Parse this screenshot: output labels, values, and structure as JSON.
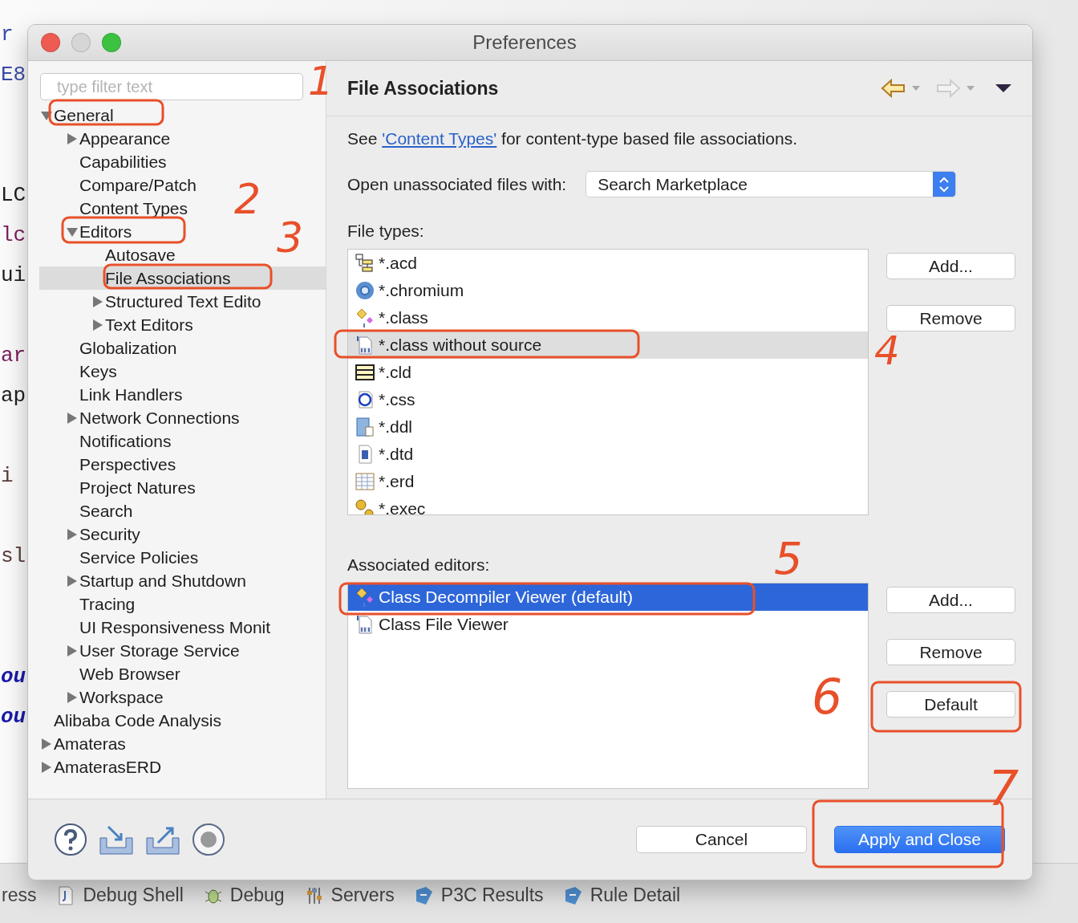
{
  "editor_background": {
    "code_lines": [
      {
        "kind": "code",
        "text": "r",
        "color": "#3b4ba8"
      },
      {
        "kind": "code",
        "text": "E8",
        "color": "#3b4ba8"
      },
      {
        "kind": "blank"
      },
      {
        "kind": "blank"
      },
      {
        "kind": "code",
        "text": "LC",
        "color": "#202020"
      },
      {
        "kind": "code",
        "text": "lc",
        "color": "#7a1c5a"
      },
      {
        "kind": "code",
        "text": "ui",
        "color": "#202020"
      },
      {
        "kind": "blank"
      },
      {
        "kind": "code",
        "text": "ar",
        "color": "#7a1c5a"
      },
      {
        "kind": "code",
        "text": "ap",
        "color": "#202020"
      },
      {
        "kind": "blank"
      },
      {
        "kind": "code",
        "text": "i",
        "color": "#5a3a3a"
      },
      {
        "kind": "blank"
      },
      {
        "kind": "code",
        "text": "sl",
        "color": "#5a3a3a"
      },
      {
        "kind": "blank"
      },
      {
        "kind": "blank"
      },
      {
        "kind": "code",
        "text": "ou",
        "color": "#1a1aa8"
      },
      {
        "kind": "code",
        "text": "ou",
        "color": "#1a1aa8"
      }
    ],
    "bottom_tabs": [
      "ress",
      "Debug Shell",
      "Debug",
      "Servers",
      "P3C Results",
      "Rule Detail"
    ]
  },
  "window": {
    "title": "Preferences"
  },
  "sidebar": {
    "filter": {
      "placeholder": "type filter text"
    },
    "tree": [
      {
        "label": "General",
        "kind": "branch",
        "expanded": true,
        "selected": false,
        "children": [
          {
            "label": "Appearance",
            "kind": "branch",
            "expanded": false,
            "selected": false
          },
          {
            "label": "Capabilities",
            "kind": "leaf",
            "selected": false
          },
          {
            "label": "Compare/Patch",
            "kind": "leaf",
            "selected": false
          },
          {
            "label": "Content Types",
            "kind": "leaf",
            "selected": false
          },
          {
            "label": "Editors",
            "kind": "branch",
            "expanded": true,
            "selected": false,
            "children": [
              {
                "label": "Autosave",
                "kind": "leaf",
                "selected": false
              },
              {
                "label": "File Associations",
                "kind": "leaf",
                "selected": true
              },
              {
                "label": "Structured Text Edito",
                "kind": "branch",
                "expanded": false,
                "selected": false
              },
              {
                "label": "Text Editors",
                "kind": "branch",
                "expanded": false,
                "selected": false
              }
            ]
          },
          {
            "label": "Globalization",
            "kind": "leaf",
            "selected": false
          },
          {
            "label": "Keys",
            "kind": "leaf",
            "selected": false
          },
          {
            "label": "Link Handlers",
            "kind": "leaf",
            "selected": false
          },
          {
            "label": "Network Connections",
            "kind": "branch",
            "expanded": false,
            "selected": false
          },
          {
            "label": "Notifications",
            "kind": "leaf",
            "selected": false
          },
          {
            "label": "Perspectives",
            "kind": "leaf",
            "selected": false
          },
          {
            "label": "Project Natures",
            "kind": "leaf",
            "selected": false
          },
          {
            "label": "Search",
            "kind": "leaf",
            "selected": false
          },
          {
            "label": "Security",
            "kind": "branch",
            "expanded": false,
            "selected": false
          },
          {
            "label": "Service Policies",
            "kind": "leaf",
            "selected": false
          },
          {
            "label": "Startup and Shutdown",
            "kind": "branch",
            "expanded": false,
            "selected": false
          },
          {
            "label": "Tracing",
            "kind": "leaf",
            "selected": false
          },
          {
            "label": "UI Responsiveness Monit",
            "kind": "leaf",
            "selected": false
          },
          {
            "label": "User Storage Service",
            "kind": "branch",
            "expanded": false,
            "selected": false
          },
          {
            "label": "Web Browser",
            "kind": "leaf",
            "selected": false
          },
          {
            "label": "Workspace",
            "kind": "branch",
            "expanded": false,
            "selected": false
          }
        ]
      },
      {
        "label": "Alibaba Code Analysis",
        "kind": "leaf",
        "selected": false
      },
      {
        "label": "Amateras",
        "kind": "branch",
        "expanded": false,
        "selected": false
      },
      {
        "label": "AmaterasERD",
        "kind": "branch",
        "expanded": false,
        "selected": false
      }
    ]
  },
  "page": {
    "title": "File Associations",
    "intro": {
      "before": "See ",
      "link": "'Content Types'",
      "after": " for content-type based file associations."
    },
    "unassociated": {
      "label": "Open unassociated files with:",
      "value": "Search Marketplace"
    },
    "file_types": {
      "label": "File types:",
      "items": [
        {
          "text": "*.acd",
          "selected": false
        },
        {
          "text": "*.chromium",
          "selected": false
        },
        {
          "text": "*.class",
          "selected": false
        },
        {
          "text": "*.class without source",
          "selected": true
        },
        {
          "text": "*.cld",
          "selected": false
        },
        {
          "text": "*.css",
          "selected": false
        },
        {
          "text": "*.ddl",
          "selected": false
        },
        {
          "text": "*.dtd",
          "selected": false
        },
        {
          "text": "*.erd",
          "selected": false
        },
        {
          "text": "*.exec",
          "selected": false
        }
      ],
      "buttons": [
        "Add...",
        "Remove"
      ]
    },
    "editors": {
      "label": "Associated editors:",
      "items": [
        {
          "text": "Class Decompiler Viewer (default)",
          "selected": true
        },
        {
          "text": "Class File Viewer",
          "selected": false
        }
      ],
      "buttons": [
        "Add...",
        "Remove",
        "Default"
      ]
    }
  },
  "footer": {
    "buttons": [
      {
        "label": "Cancel",
        "kind": "secondary"
      },
      {
        "label": "Apply and Close",
        "kind": "primary"
      }
    ]
  },
  "annotations": [
    "1",
    "2",
    "3",
    "4",
    "5",
    "6",
    "7"
  ]
}
